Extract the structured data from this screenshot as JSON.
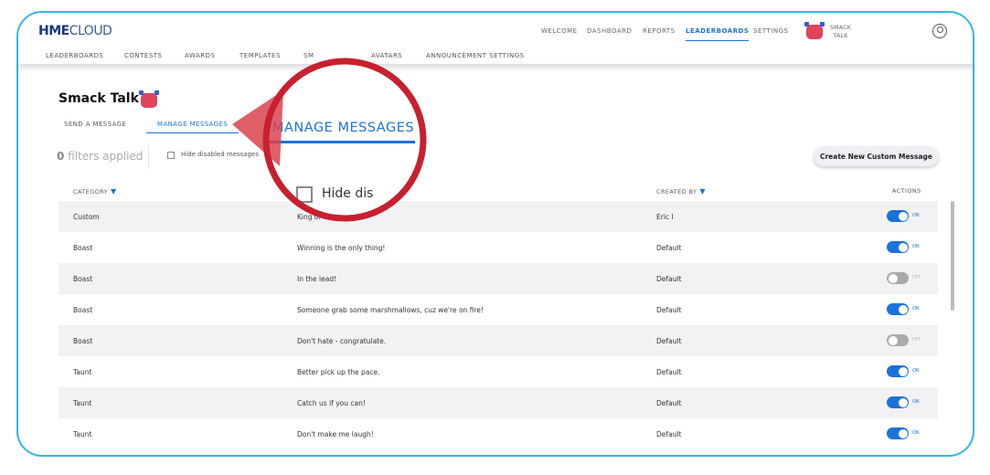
{
  "brand": {
    "name_bold": "HME",
    "name_light": "CLOUD"
  },
  "main_nav": [
    {
      "label": "WELCOME"
    },
    {
      "label": "DASHBOARD"
    },
    {
      "label": "REPORTS"
    },
    {
      "label": "LEADERBOARDS",
      "active": true
    },
    {
      "label": "SETTINGS"
    }
  ],
  "smack_talk_nav": {
    "line1": "SMACK",
    "line2": "TALK"
  },
  "sub_nav": [
    {
      "label": "LEADERBOARDS"
    },
    {
      "label": "CONTESTS"
    },
    {
      "label": "AWARDS"
    },
    {
      "label": "TEMPLATES"
    },
    {
      "label": "SM"
    },
    {
      "label": "AVATARS"
    },
    {
      "label": "ANNOUNCEMENT SETTINGS"
    }
  ],
  "page": {
    "title": "Smack Talk"
  },
  "tabs": [
    {
      "label": "SEND A MESSAGE"
    },
    {
      "label": "MANAGE MESSAGES",
      "active": true
    }
  ],
  "filters": {
    "count": "0",
    "text": " filters applied",
    "hide_disabled": "Hide disabled messages"
  },
  "create_button": "Create New Custom Message",
  "columns": {
    "category": "CATEGORY",
    "created_by": "CREATED BY",
    "actions": "ACTIONS"
  },
  "rows": [
    {
      "category": "Custom",
      "message": "King of the World.",
      "created_by": "Eric I",
      "enabled": true,
      "toggle_label": "ON"
    },
    {
      "category": "Boast",
      "message": "Winning is the only thing!",
      "created_by": "Default",
      "enabled": true,
      "toggle_label": "ON"
    },
    {
      "category": "Boast",
      "message": "In the lead!",
      "created_by": "Default",
      "enabled": false,
      "toggle_label": "OFF"
    },
    {
      "category": "Boast",
      "message": "Someone grab some marshmallows, cuz we're on fire!",
      "created_by": "Default",
      "enabled": true,
      "toggle_label": "ON"
    },
    {
      "category": "Boast",
      "message": "Don't hate - congratulate.",
      "created_by": "Default",
      "enabled": false,
      "toggle_label": "OFF"
    },
    {
      "category": "Taunt",
      "message": "Better pick up the pace.",
      "created_by": "Default",
      "enabled": true,
      "toggle_label": "ON"
    },
    {
      "category": "Taunt",
      "message": "Catch us if you can!",
      "created_by": "Default",
      "enabled": true,
      "toggle_label": "ON"
    },
    {
      "category": "Taunt",
      "message": "Don't make me laugh!",
      "created_by": "Default",
      "enabled": true,
      "toggle_label": "ON"
    }
  ],
  "magnifier": {
    "title": "MANAGE MESSAGES",
    "hide_text": "Hide dis"
  },
  "colors": {
    "accent": "#1a73d9",
    "frame": "#34b4e4",
    "callout": "#c8202e"
  }
}
